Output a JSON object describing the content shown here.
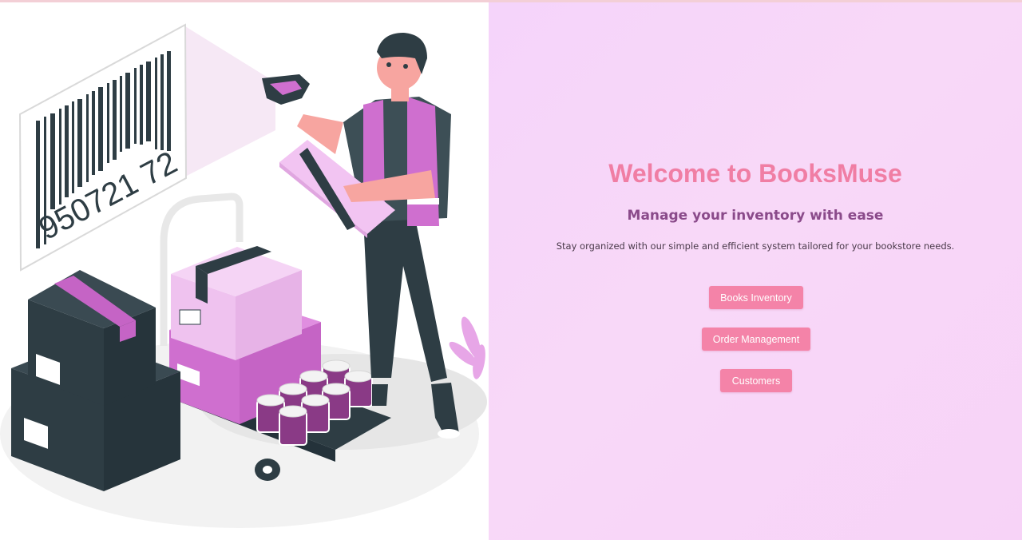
{
  "hero": {
    "title": "Welcome to BooksMuse",
    "subtitle": "Manage your inventory with ease",
    "description": "Stay organized with our simple and efficient system tailored for your bookstore needs."
  },
  "nav_buttons": {
    "books_inventory": "Books Inventory",
    "order_management": "Order Management",
    "customers": "Customers"
  },
  "illustration": {
    "barcode_number": "950721 72",
    "icon": "warehouse-barcode-scanning-illustration"
  },
  "colors": {
    "accent": "#f483a8",
    "title": "#f07ea4",
    "subtitle": "#8a4a8a",
    "panel_background": "#f7d5f9",
    "box_purple": "#cf6fcf",
    "box_dark": "#2e3d44"
  }
}
